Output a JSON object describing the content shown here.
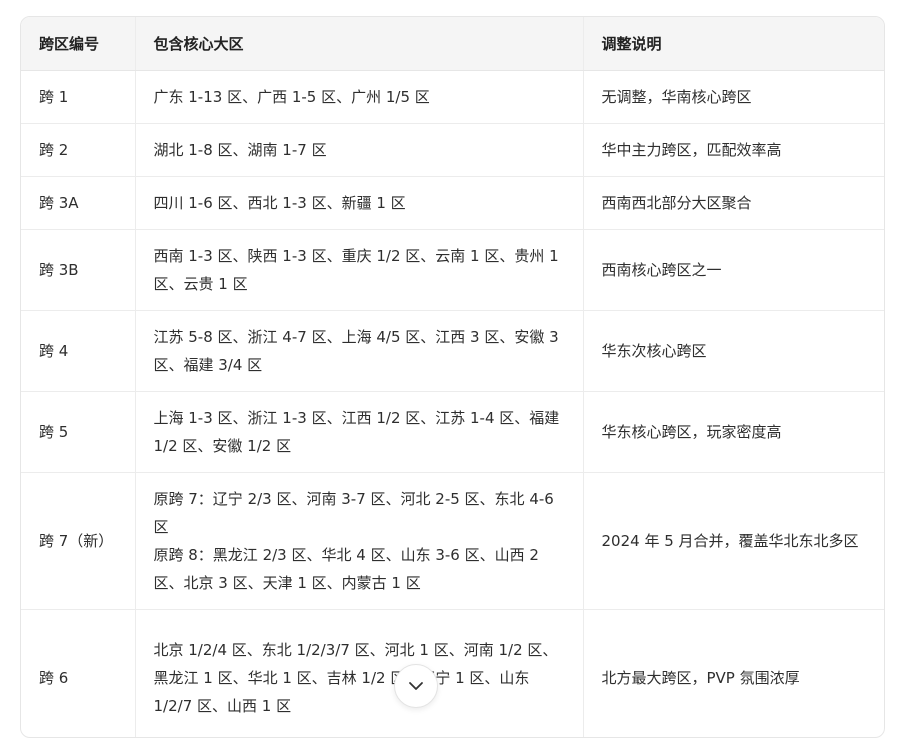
{
  "table": {
    "headers": [
      "跨区编号",
      "包含核心大区",
      "调整说明"
    ],
    "rows": [
      {
        "id": "跨 1",
        "regions": [
          "广东 1-13 区、广西 1-5 区、广州 1/5 区"
        ],
        "note": "无调整，华南核心跨区"
      },
      {
        "id": "跨 2",
        "regions": [
          "湖北 1-8 区、湖南 1-7 区"
        ],
        "note": "华中主力跨区，匹配效率高"
      },
      {
        "id": "跨 3A",
        "regions": [
          "四川 1-6 区、西北 1-3 区、新疆 1 区"
        ],
        "note": "西南西北部分大区聚合"
      },
      {
        "id": "跨 3B",
        "regions": [
          "西南 1-3 区、陕西 1-3 区、重庆 1/2 区、云南 1 区、贵州 1 区、云贵 1 区"
        ],
        "note": "西南核心跨区之一"
      },
      {
        "id": "跨 4",
        "regions": [
          "江苏 5-8 区、浙江 4-7 区、上海 4/5 区、江西 3 区、安徽 3 区、福建 3/4 区"
        ],
        "note": "华东次核心跨区"
      },
      {
        "id": "跨 5",
        "regions": [
          "上海 1-3 区、浙江 1-3 区、江西 1/2 区、江苏 1-4 区、福建 1/2 区、安徽 1/2 区"
        ],
        "note": "华东核心跨区，玩家密度高"
      },
      {
        "id": "跨 7（新）",
        "regions": [
          "原跨 7：辽宁 2/3 区、河南 3-7 区、河北 2-5 区、东北 4-6 区",
          "原跨 8：黑龙江 2/3 区、华北 4 区、山东 3-6 区、山西 2 区、北京 3 区、天津 1 区、内蒙古 1 区"
        ],
        "note": "2024 年 5 月合并，覆盖华北东北多区"
      },
      {
        "id": "跨 6",
        "regions": [
          "北京 1/2/4 区、东北 1/2/3/7 区、河北 1 区、河南 1/2 区、黑龙江 1 区、华北 1 区、吉林 1/2 区、辽宁 1 区、山东 1/2/7 区、山西 1 区"
        ],
        "note": "北方最大跨区，PVP 氛围浓厚"
      }
    ]
  },
  "scroll_button": {
    "icon": "chevron-down-icon"
  }
}
